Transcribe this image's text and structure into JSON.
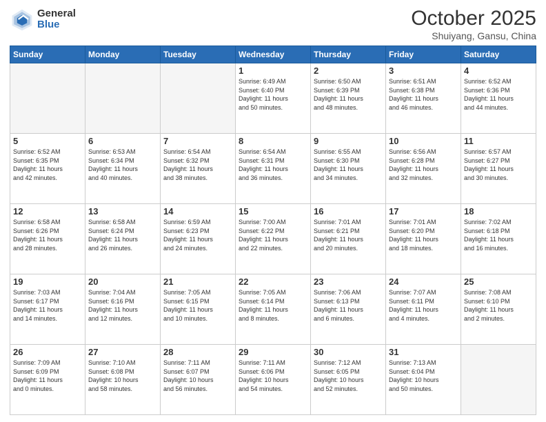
{
  "logo": {
    "general": "General",
    "blue": "Blue"
  },
  "header": {
    "month": "October 2025",
    "location": "Shuiyang, Gansu, China"
  },
  "weekdays": [
    "Sunday",
    "Monday",
    "Tuesday",
    "Wednesday",
    "Thursday",
    "Friday",
    "Saturday"
  ],
  "weeks": [
    [
      {
        "day": "",
        "info": ""
      },
      {
        "day": "",
        "info": ""
      },
      {
        "day": "",
        "info": ""
      },
      {
        "day": "1",
        "info": "Sunrise: 6:49 AM\nSunset: 6:40 PM\nDaylight: 11 hours\nand 50 minutes."
      },
      {
        "day": "2",
        "info": "Sunrise: 6:50 AM\nSunset: 6:39 PM\nDaylight: 11 hours\nand 48 minutes."
      },
      {
        "day": "3",
        "info": "Sunrise: 6:51 AM\nSunset: 6:38 PM\nDaylight: 11 hours\nand 46 minutes."
      },
      {
        "day": "4",
        "info": "Sunrise: 6:52 AM\nSunset: 6:36 PM\nDaylight: 11 hours\nand 44 minutes."
      }
    ],
    [
      {
        "day": "5",
        "info": "Sunrise: 6:52 AM\nSunset: 6:35 PM\nDaylight: 11 hours\nand 42 minutes."
      },
      {
        "day": "6",
        "info": "Sunrise: 6:53 AM\nSunset: 6:34 PM\nDaylight: 11 hours\nand 40 minutes."
      },
      {
        "day": "7",
        "info": "Sunrise: 6:54 AM\nSunset: 6:32 PM\nDaylight: 11 hours\nand 38 minutes."
      },
      {
        "day": "8",
        "info": "Sunrise: 6:54 AM\nSunset: 6:31 PM\nDaylight: 11 hours\nand 36 minutes."
      },
      {
        "day": "9",
        "info": "Sunrise: 6:55 AM\nSunset: 6:30 PM\nDaylight: 11 hours\nand 34 minutes."
      },
      {
        "day": "10",
        "info": "Sunrise: 6:56 AM\nSunset: 6:28 PM\nDaylight: 11 hours\nand 32 minutes."
      },
      {
        "day": "11",
        "info": "Sunrise: 6:57 AM\nSunset: 6:27 PM\nDaylight: 11 hours\nand 30 minutes."
      }
    ],
    [
      {
        "day": "12",
        "info": "Sunrise: 6:58 AM\nSunset: 6:26 PM\nDaylight: 11 hours\nand 28 minutes."
      },
      {
        "day": "13",
        "info": "Sunrise: 6:58 AM\nSunset: 6:24 PM\nDaylight: 11 hours\nand 26 minutes."
      },
      {
        "day": "14",
        "info": "Sunrise: 6:59 AM\nSunset: 6:23 PM\nDaylight: 11 hours\nand 24 minutes."
      },
      {
        "day": "15",
        "info": "Sunrise: 7:00 AM\nSunset: 6:22 PM\nDaylight: 11 hours\nand 22 minutes."
      },
      {
        "day": "16",
        "info": "Sunrise: 7:01 AM\nSunset: 6:21 PM\nDaylight: 11 hours\nand 20 minutes."
      },
      {
        "day": "17",
        "info": "Sunrise: 7:01 AM\nSunset: 6:20 PM\nDaylight: 11 hours\nand 18 minutes."
      },
      {
        "day": "18",
        "info": "Sunrise: 7:02 AM\nSunset: 6:18 PM\nDaylight: 11 hours\nand 16 minutes."
      }
    ],
    [
      {
        "day": "19",
        "info": "Sunrise: 7:03 AM\nSunset: 6:17 PM\nDaylight: 11 hours\nand 14 minutes."
      },
      {
        "day": "20",
        "info": "Sunrise: 7:04 AM\nSunset: 6:16 PM\nDaylight: 11 hours\nand 12 minutes."
      },
      {
        "day": "21",
        "info": "Sunrise: 7:05 AM\nSunset: 6:15 PM\nDaylight: 11 hours\nand 10 minutes."
      },
      {
        "day": "22",
        "info": "Sunrise: 7:05 AM\nSunset: 6:14 PM\nDaylight: 11 hours\nand 8 minutes."
      },
      {
        "day": "23",
        "info": "Sunrise: 7:06 AM\nSunset: 6:13 PM\nDaylight: 11 hours\nand 6 minutes."
      },
      {
        "day": "24",
        "info": "Sunrise: 7:07 AM\nSunset: 6:11 PM\nDaylight: 11 hours\nand 4 minutes."
      },
      {
        "day": "25",
        "info": "Sunrise: 7:08 AM\nSunset: 6:10 PM\nDaylight: 11 hours\nand 2 minutes."
      }
    ],
    [
      {
        "day": "26",
        "info": "Sunrise: 7:09 AM\nSunset: 6:09 PM\nDaylight: 11 hours\nand 0 minutes."
      },
      {
        "day": "27",
        "info": "Sunrise: 7:10 AM\nSunset: 6:08 PM\nDaylight: 10 hours\nand 58 minutes."
      },
      {
        "day": "28",
        "info": "Sunrise: 7:11 AM\nSunset: 6:07 PM\nDaylight: 10 hours\nand 56 minutes."
      },
      {
        "day": "29",
        "info": "Sunrise: 7:11 AM\nSunset: 6:06 PM\nDaylight: 10 hours\nand 54 minutes."
      },
      {
        "day": "30",
        "info": "Sunrise: 7:12 AM\nSunset: 6:05 PM\nDaylight: 10 hours\nand 52 minutes."
      },
      {
        "day": "31",
        "info": "Sunrise: 7:13 AM\nSunset: 6:04 PM\nDaylight: 10 hours\nand 50 minutes."
      },
      {
        "day": "",
        "info": ""
      }
    ]
  ]
}
